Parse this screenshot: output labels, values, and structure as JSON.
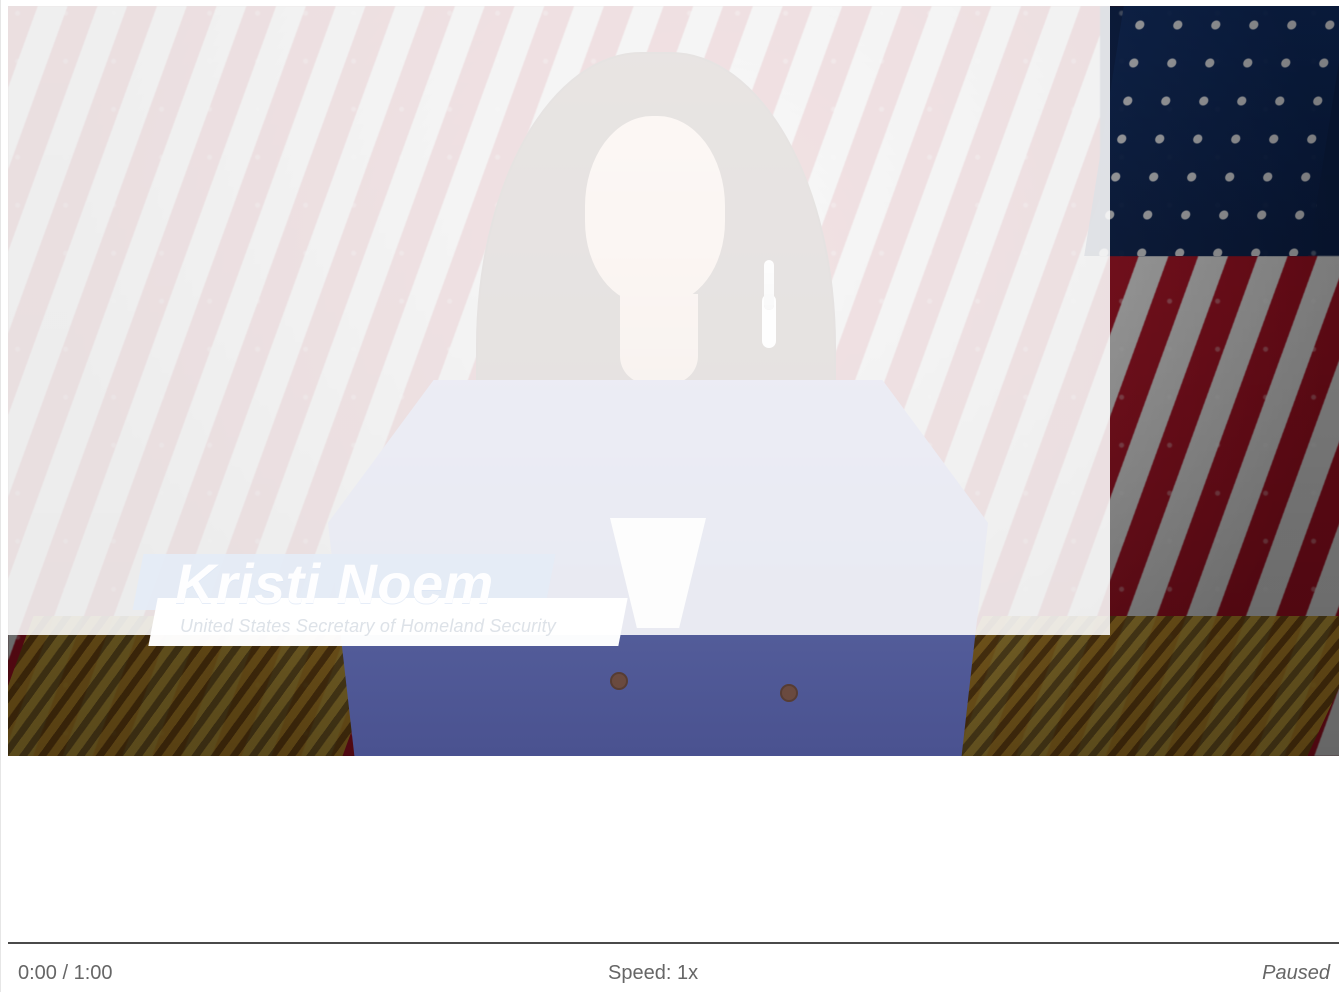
{
  "video": {
    "lower_third": {
      "name": "Kristi Noem",
      "title": "United States Secretary of Homeland Security"
    }
  },
  "controls": {
    "time": "0:00 / 1:00",
    "speed": "Speed: 1x",
    "status": "Paused"
  },
  "colors": {
    "overlay": "#ffffff",
    "control_text": "#666666",
    "control_border": "#4a4a4a",
    "flag_red": "#b41226",
    "flag_blue": "#0d2555",
    "jacket": "#56609d"
  }
}
